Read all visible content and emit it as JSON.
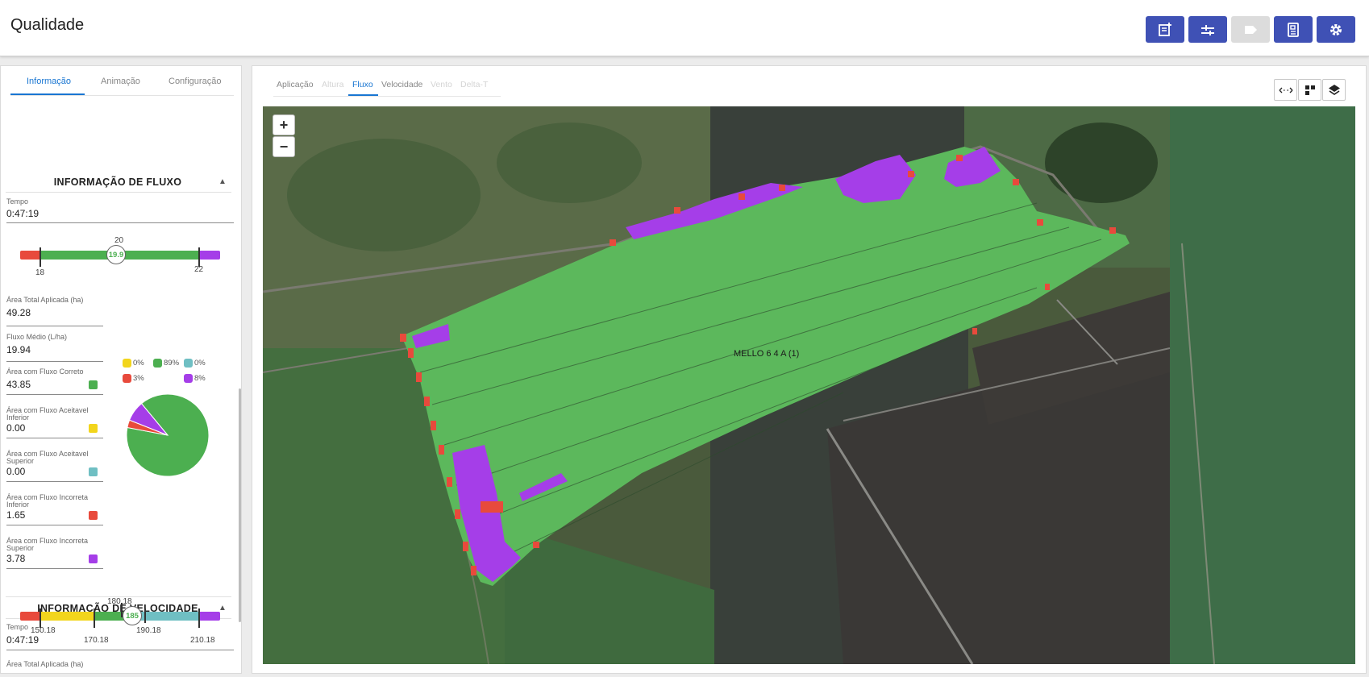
{
  "header": {
    "title": "Qualidade",
    "buttons": [
      {
        "name": "add-report-button",
        "icon": "note-add-icon"
      },
      {
        "name": "compare-button",
        "icon": "sliders-icon"
      },
      {
        "name": "disabled-label-button",
        "icon": "label-icon"
      },
      {
        "name": "report-button",
        "icon": "document-icon"
      },
      {
        "name": "settings-button",
        "icon": "gear-icon"
      }
    ],
    "accent": "#3f51b5"
  },
  "left_panel": {
    "tabs": [
      "Informação",
      "Animação",
      "Configuração"
    ],
    "active_tab": "Informação",
    "flow": {
      "title": "INFORMAÇÃO DE FLUXO",
      "tempo_label": "Tempo",
      "tempo_value": "0:47:19",
      "scale": {
        "min_label": "18",
        "target_label": "20",
        "max_label": "22",
        "current": "19.9"
      },
      "area_total_label": "Área Total Aplicada (ha)",
      "area_total_value": "49.28",
      "fluxo_medio_label": "Fluxo Médio (L/ha)",
      "fluxo_medio_value": "19.94",
      "rows": [
        {
          "label": "Área com Fluxo Correto",
          "value": "43.85",
          "color": "#4caf50"
        },
        {
          "label": "Área com Fluxo Aceitavel Inferior",
          "value": "0.00",
          "color": "#f2d51c"
        },
        {
          "label": "Área com Fluxo Aceitavel Superior",
          "value": "0.00",
          "color": "#6fbfc3"
        },
        {
          "label": "Área com Fluxo Incorreta Inferior",
          "value": "1.65",
          "color": "#e84a3c"
        },
        {
          "label": "Área com Fluxo Incorreta Superior",
          "value": "3.78",
          "color": "#a53ee8"
        }
      ],
      "legend": [
        {
          "label": "0%",
          "color": "#f2d51c"
        },
        {
          "label": "89%",
          "color": "#4caf50"
        },
        {
          "label": "0%",
          "color": "#6fbfc3"
        },
        {
          "label": "3%",
          "color": "#e84a3c"
        },
        {
          "label": "8%",
          "color": "#a53ee8"
        }
      ],
      "pie": [
        {
          "name": "Correto",
          "value": 89,
          "color": "#4caf50"
        },
        {
          "name": "Incorreta Inferior",
          "value": 3,
          "color": "#e84a3c"
        },
        {
          "name": "Incorreta Superior",
          "value": 8,
          "color": "#a53ee8"
        }
      ]
    },
    "speed": {
      "title": "INFORMAÇÃO DE VELOCIDADE",
      "tempo_label": "Tempo",
      "tempo_value": "0:47:19",
      "scale": {
        "l1": "150.18",
        "l2": "170.18",
        "l3": "180.18",
        "l4": "190.18",
        "l5": "210.18",
        "current": "185"
      },
      "area_total_label": "Área Total Aplicada (ha)"
    }
  },
  "right_panel": {
    "tabs": [
      {
        "label": "Aplicação",
        "state": "normal"
      },
      {
        "label": "Altura",
        "state": "disabled"
      },
      {
        "label": "Fluxo",
        "state": "active"
      },
      {
        "label": "Velocidade",
        "state": "normal"
      },
      {
        "label": "Vento",
        "state": "disabled"
      },
      {
        "label": "Delta-T",
        "state": "disabled"
      }
    ],
    "tools": [
      "compare-arrows-icon",
      "grid-icon",
      "layers-icon"
    ],
    "map": {
      "zoom_in": "+",
      "zoom_out": "−",
      "field_label": "MELLO 6 4 A (1)"
    }
  }
}
